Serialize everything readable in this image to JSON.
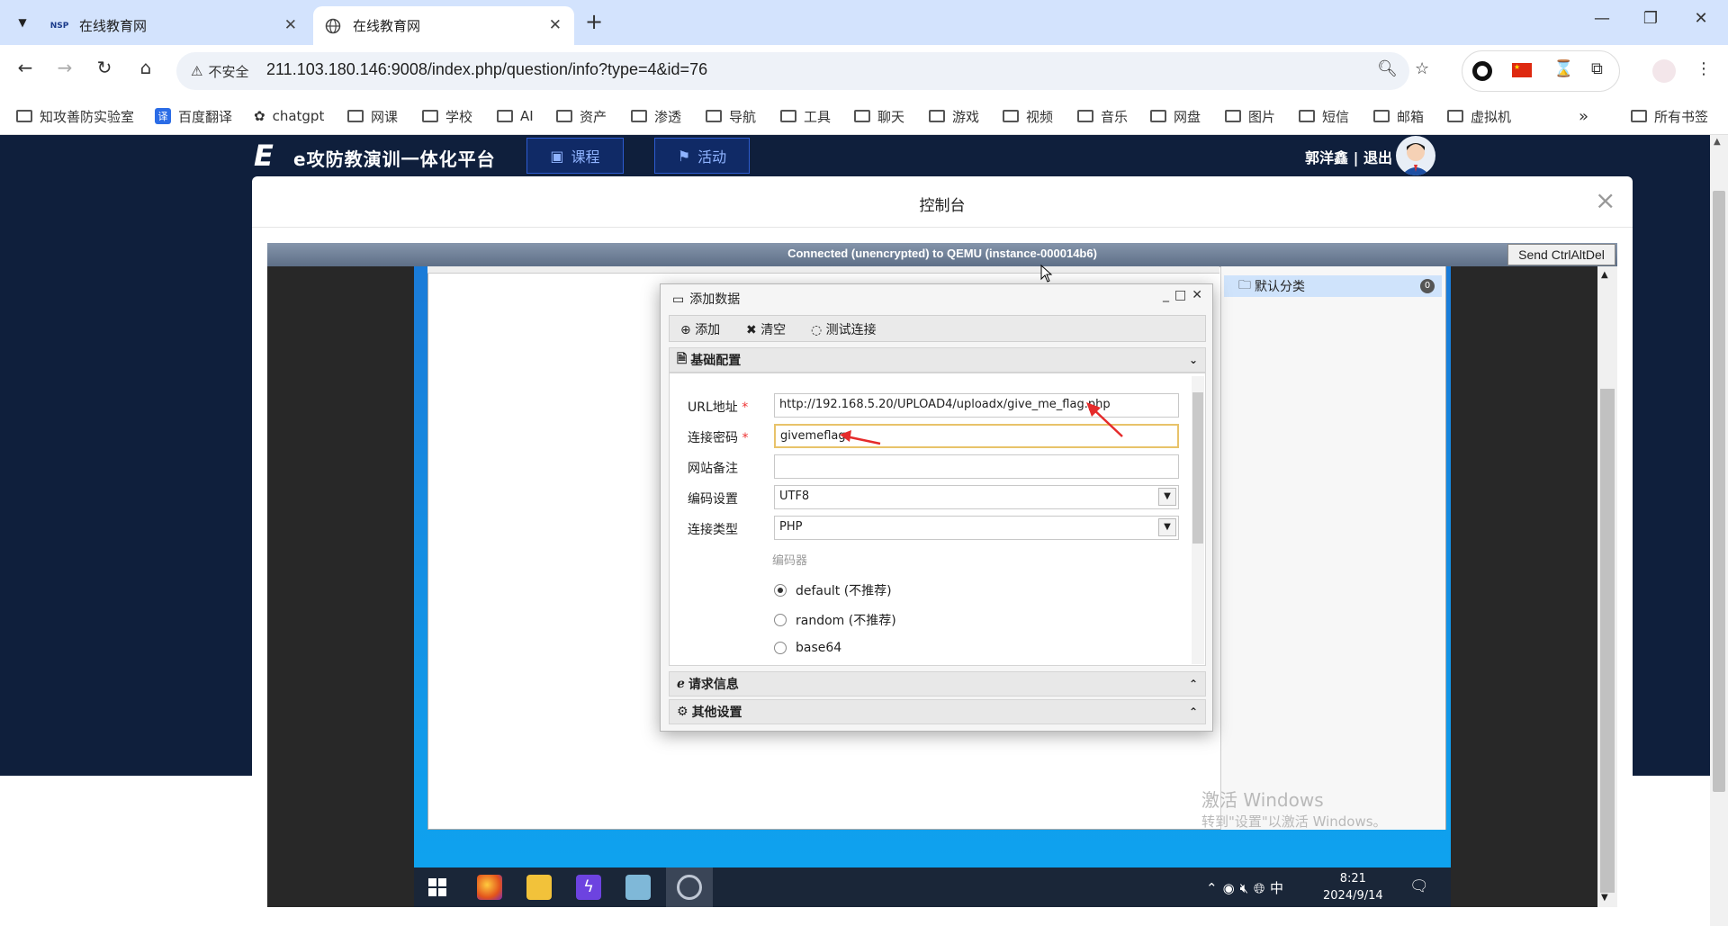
{
  "browser": {
    "tabs": [
      {
        "title": "在线教育网",
        "favicon": "NSP"
      },
      {
        "title": "在线教育网",
        "favicon": "globe"
      }
    ],
    "new_tab": "+",
    "insecure_label": "不安全",
    "url": "211.103.180.146:9008/index.php/question/info?type=4&id=76",
    "bookmarks": [
      "知攻善防实验室",
      "百度翻译",
      "chatgpt",
      "网课",
      "学校",
      "AI",
      "资产",
      "渗透",
      "导航",
      "工具",
      "聊天",
      "游戏",
      "视频",
      "音乐",
      "网盘",
      "图片",
      "短信",
      "邮箱",
      "虚拟机"
    ],
    "bookmarks_more": "»",
    "all_bookmarks": "所有书签"
  },
  "site": {
    "title": "e攻防教演训一体化平台",
    "nav": [
      "课程",
      "活动"
    ],
    "user": "郭洋鑫 | 退出"
  },
  "modal": {
    "title": "控制台",
    "close": "×"
  },
  "vnc": {
    "status": "Connected (unencrypted) to QEMU (instance-000014b6)",
    "send_cad": "Send CtrlAltDel"
  },
  "remote": {
    "category": "默认分类",
    "category_count": "0",
    "watermark_line1": "激活 Windows",
    "watermark_line2": "转到\"设置\"以激活 Windows。",
    "clock_time": "8:21",
    "clock_date": "2024/9/14",
    "ime": "中",
    "dialog": {
      "title": "添加数据",
      "toolbar": [
        "添加",
        "清空",
        "测试连接"
      ],
      "section_basic": "基础配置",
      "section_request": "请求信息",
      "section_other": "其他设置",
      "fields": {
        "url_label": "URL地址",
        "url_value": "http://192.168.5.20/UPLOAD4/uploadx/give_me_flag.php",
        "pwd_label": "连接密码",
        "pwd_value": "givemeflag",
        "note_label": "网站备注",
        "note_value": "",
        "encoding_label": "编码设置",
        "encoding_value": "UTF8",
        "type_label": "连接类型",
        "type_value": "PHP"
      },
      "encoder_label": "编码器",
      "encoders": [
        "default (不推荐)",
        "random (不推荐)",
        "base64"
      ],
      "encoder_selected": 0,
      "required_mark": "*"
    }
  },
  "colors": {
    "page_bg": "#0f1f3c",
    "tabstrip": "#d3e3fd",
    "arrow": "#e52b2b"
  }
}
